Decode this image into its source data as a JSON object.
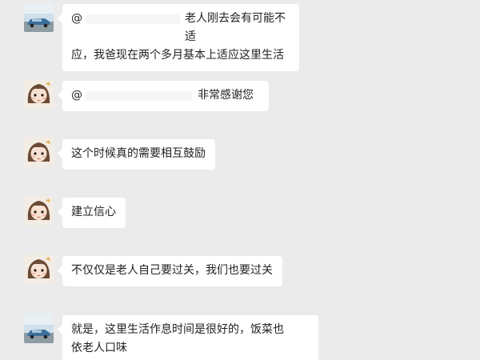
{
  "messages": [
    {
      "avatar": "car-photo-icon",
      "mention_symbol": "@",
      "mention_tail": "老人刚去会有可能不适",
      "line2": "应，我爸现在两个多月基本上适应这里生活"
    },
    {
      "avatar": "cartoon-girl-icon",
      "mention_symbol": "@",
      "mention_tail": "非常感谢您"
    },
    {
      "avatar": "cartoon-girl-icon",
      "text": "这个时候真的需要相互鼓励"
    },
    {
      "avatar": "cartoon-girl-icon",
      "text": "建立信心"
    },
    {
      "avatar": "cartoon-girl-icon",
      "text": "不仅仅是老人自己要过关，我们也要过关"
    },
    {
      "avatar": "car-photo-icon",
      "line1": "就是，这里生活作息时间是很好的，饭菜也",
      "line2": "依老人口味"
    }
  ]
}
